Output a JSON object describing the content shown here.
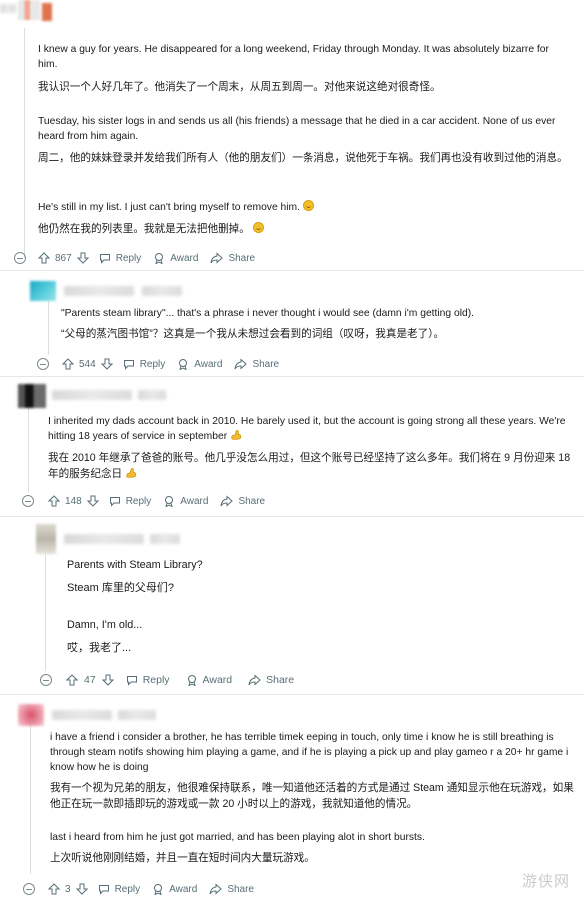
{
  "comments": [
    {
      "paragraphs_en": [
        "I knew a guy for years. He disappeared for a long weekend, Friday through Monday. It was absolutely bizarre for him.",
        "Tuesday, his sister logs in and sends us all (his friends) a message that he died in a car accident. None of us ever heard from him again.",
        "He's still in my list. I just can't bring myself to remove him."
      ],
      "paragraphs_zh": [
        "我认识一个人好几年了。他消失了一个周末，从周五到周一。对他来说这绝对很奇怪。",
        "周二，他的妹妹登录并发给我们所有人（他的朋友们）一条消息，说他死于车祸。我们再也没有收到过他的消息。",
        "他仍然在我的列表里。我就是无法把他删掉。"
      ],
      "votes": "867",
      "reply": "Reply",
      "award": "Award",
      "share": "Share",
      "avatar_color": "#e0734f"
    },
    {
      "paragraphs_en": [
        "\"Parents steam library\"... that's a phrase i never thought i would see (damn i'm getting old)."
      ],
      "paragraphs_zh": [
        "“父母的蒸汽图书馆”？这真是一个我从未想过会看到的词组（叹呀，我真是老了）。"
      ],
      "votes": "544",
      "reply": "Reply",
      "award": "Award",
      "share": "Share",
      "avatar_color": "#3fbfd0"
    },
    {
      "paragraphs_en": [
        "I inherited my dads account back in 2010. He barely used it, but the account is going strong all these years. We're hitting 18 years of service in september"
      ],
      "paragraphs_zh": [
        "我在 2010 年继承了爸爸的账号。他几乎没怎么用过，但这个账号已经坚持了这么多年。我们将在 9 月份迎来 18 年的服务纪念日"
      ],
      "votes": "148",
      "reply": "Reply",
      "award": "Award",
      "share": "Share",
      "avatar_color": "#2a2a2a"
    },
    {
      "paragraphs_en": [
        "Parents with Steam Library?",
        "Damn, I'm old..."
      ],
      "paragraphs_zh": [
        "Steam 库里的父母们?",
        "哎，我老了..."
      ],
      "votes": "47",
      "reply": "Reply",
      "award": "Award",
      "share": "Share",
      "avatar_color": "#c9c6bd"
    },
    {
      "paragraphs_en": [
        "i have a friend i consider a brother, he has terrible timek eeping in touch, only time i know he is still breathing is through steam notifs showing him playing a game, and if he is playing a pick up and play gameo r a 20+ hr game i know how he is doing",
        "last i heard from him he just got married, and has been playing alot in short bursts."
      ],
      "paragraphs_zh": [
        "我有一个视为兄弟的朋友，他很难保持联系，唯一知道他还活着的方式是通过 Steam 通知显示他在玩游戏，如果他正在玩一款即插即玩的游戏或一款 20 小时以上的游戏，我就知道他的情况。",
        "上次听说他刚刚结婚，并且一直在短时间内大量玩游戏。"
      ],
      "votes": "3",
      "reply": "Reply",
      "award": "Award",
      "share": "Share",
      "avatar_color": "#d9707f"
    }
  ],
  "watermark": "游侠网",
  "colors": {
    "meta": "#576f76",
    "thread_line": "#dcdee0",
    "text": "#1a1a1b"
  },
  "icons": [
    "upvote-icon",
    "downvote-icon",
    "reply-icon",
    "award-icon",
    "share-icon",
    "collapse-icon",
    "smile-emoji-icon",
    "flexed-arm-emoji-icon"
  ]
}
